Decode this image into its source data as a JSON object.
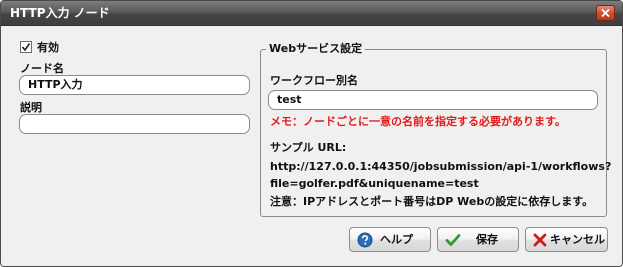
{
  "window": {
    "title": "HTTP入力 ノード"
  },
  "left": {
    "enabled_label": "有効",
    "enabled_checked": true,
    "node_name_label": "ノード名",
    "node_name_value": "HTTP入力",
    "description_label": "説明",
    "description_value": ""
  },
  "web_service": {
    "legend": "Webサービス設定",
    "workflow_alias_label": "ワークフロー別名",
    "workflow_alias_value": "test",
    "memo": "メモ：ノードごとに一意の名前を指定する必要があります。",
    "sample_url_label": "サンプル URL:",
    "sample_url_line1": "http://127.0.0.1:44350/jobsubmission/api-1/workflows?",
    "sample_url_line2": "file=golfer.pdf&uniquename=test",
    "caution": "注意：IPアドレスとポート番号はDP Webの設定に依存します。"
  },
  "buttons": {
    "help": "ヘルプ",
    "save": "保存",
    "cancel": "キャンセル"
  },
  "icons": {
    "close": "close-x-icon",
    "check": "checkmark-icon",
    "help": "help-question-icon",
    "save": "green-check-icon",
    "cancel": "red-x-icon"
  },
  "colors": {
    "titlebar": "#4a4a4a",
    "memo_red": "#e21a1a",
    "close_red": "#c94a2f",
    "save_green": "#2e9a2e",
    "help_blue": "#2f6bb5",
    "cancel_red": "#cc1b1b"
  }
}
